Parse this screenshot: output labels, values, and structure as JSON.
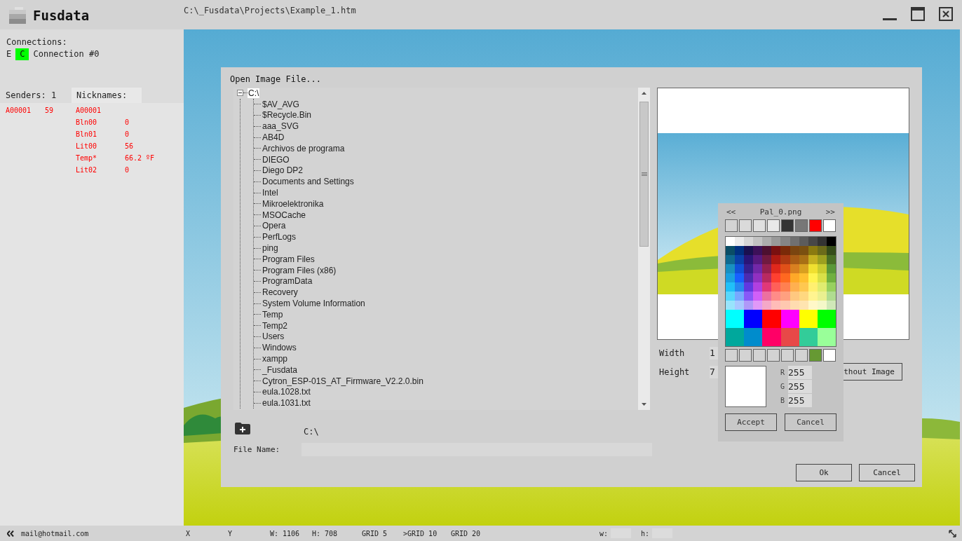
{
  "app": {
    "title": "Fusdata",
    "file_path": "C:\\_Fusdata\\Projects\\Example_1.htm"
  },
  "connections": {
    "label": "Connections:",
    "items": [
      {
        "prefix": "E",
        "badge": "C",
        "name": "Connection #0",
        "color": "#00ff00"
      }
    ]
  },
  "senders": {
    "label": "Senders: 1",
    "rows": [
      {
        "id": "A00001",
        "value": "59"
      }
    ]
  },
  "nicknames": {
    "label": "Nicknames:",
    "rows": [
      {
        "name": "A00001"
      },
      {
        "name": "Bln00",
        "value": "0"
      },
      {
        "name": "Bln01",
        "value": "0"
      },
      {
        "name": "Lit00",
        "value": "56"
      },
      {
        "name": "Temp*",
        "value": "66.2 ºF"
      },
      {
        "name": "Lit02",
        "value": "0"
      }
    ]
  },
  "dialog": {
    "title": "Open Image File...",
    "tree": {
      "label": "C:\\",
      "expanded": true,
      "selected": true,
      "children": [
        {
          "label": "$AV_AVG",
          "selected": false
        },
        {
          "label": "$Recycle.Bin",
          "selected": false
        },
        {
          "label": "aaa_SVG",
          "selected": false
        },
        {
          "label": "AB4D",
          "selected": false
        },
        {
          "label": "Archivos de programa",
          "selected": false
        },
        {
          "label": "DIEGO",
          "selected": false
        },
        {
          "label": "Diego DP2",
          "selected": false
        },
        {
          "label": "Documents and Settings",
          "selected": false
        },
        {
          "label": "Intel",
          "selected": false
        },
        {
          "label": "Mikroelektronika",
          "selected": false
        },
        {
          "label": "MSOCache",
          "selected": false
        },
        {
          "label": "Opera",
          "selected": false
        },
        {
          "label": "PerfLogs",
          "selected": false
        },
        {
          "label": "ping",
          "selected": false
        },
        {
          "label": "Program Files",
          "selected": false
        },
        {
          "label": "Program Files (x86)",
          "selected": false
        },
        {
          "label": "ProgramData",
          "selected": false
        },
        {
          "label": "Recovery",
          "selected": false
        },
        {
          "label": "System Volume Information",
          "selected": false
        },
        {
          "label": "Temp",
          "selected": false
        },
        {
          "label": "Temp2",
          "selected": false
        },
        {
          "label": "Users",
          "selected": false
        },
        {
          "label": "Windows",
          "selected": false
        },
        {
          "label": "xampp",
          "selected": false
        },
        {
          "label": "_Fusdata",
          "selected": false
        },
        {
          "label": "Cytron_ESP-01S_AT_Firmware_V2.2.0.bin",
          "selected": false
        },
        {
          "label": "eula.1028.txt",
          "selected": false
        },
        {
          "label": "eula.1031.txt",
          "selected": false
        }
      ]
    },
    "path": "C:\\",
    "file_name_label": "File Name:",
    "width_label": "Width",
    "width_value": "1",
    "height_label": "Height",
    "height_value": "7",
    "partial_button": "thout Image",
    "buttons": [
      {
        "label": "Ok"
      },
      {
        "label": "Cancel"
      }
    ]
  },
  "palette": {
    "prev": "<<",
    "title": "Pal_0.png",
    "next": ">>",
    "favorites": [
      {
        "color": "#d3d3d3"
      },
      {
        "color": "#dadada"
      },
      {
        "color": "#e0e0e0"
      },
      {
        "color": "#e8e8e8"
      },
      {
        "color": "#333333"
      },
      {
        "color": "#777777"
      },
      {
        "color": "#ff0000"
      },
      {
        "color": "#ffffff"
      }
    ],
    "grid": [
      [
        {
          "color": "#ffffff"
        },
        {
          "color": "#ebebeb"
        },
        {
          "color": "#d6d6d6"
        },
        {
          "color": "#c2c2c2"
        },
        {
          "color": "#adadad"
        },
        {
          "color": "#999999"
        },
        {
          "color": "#858585"
        },
        {
          "color": "#707070"
        },
        {
          "color": "#5c5c5c"
        },
        {
          "color": "#474747"
        },
        {
          "color": "#333333"
        },
        {
          "color": "#000000"
        }
      ],
      [
        {
          "color": "#0a4d66"
        },
        {
          "color": "#003080"
        },
        {
          "color": "#1a1050"
        },
        {
          "color": "#3d1059"
        },
        {
          "color": "#4d1030"
        },
        {
          "color": "#7a1010"
        },
        {
          "color": "#7a2a08"
        },
        {
          "color": "#7a4510"
        },
        {
          "color": "#7a5010"
        },
        {
          "color": "#8a7a10"
        },
        {
          "color": "#6b6b1a"
        },
        {
          "color": "#364d1a"
        }
      ],
      [
        {
          "color": "#0f6a90"
        },
        {
          "color": "#0a40a8"
        },
        {
          "color": "#2a1578"
        },
        {
          "color": "#581a80"
        },
        {
          "color": "#701a40"
        },
        {
          "color": "#ae1a12"
        },
        {
          "color": "#ad3a12"
        },
        {
          "color": "#a85c15"
        },
        {
          "color": "#a87015"
        },
        {
          "color": "#c4b020"
        },
        {
          "color": "#9ca020"
        },
        {
          "color": "#4a7025"
        }
      ],
      [
        {
          "color": "#1990c0"
        },
        {
          "color": "#1050d8"
        },
        {
          "color": "#362090"
        },
        {
          "color": "#7228a8"
        },
        {
          "color": "#952050"
        },
        {
          "color": "#e0281c"
        },
        {
          "color": "#e05018"
        },
        {
          "color": "#d88020"
        },
        {
          "color": "#d8a020"
        },
        {
          "color": "#f0e030"
        },
        {
          "color": "#c8cc30"
        },
        {
          "color": "#5a9838"
        }
      ],
      [
        {
          "color": "#1aa0e0"
        },
        {
          "color": "#1860ff"
        },
        {
          "color": "#4a2cb0"
        },
        {
          "color": "#9030c0"
        },
        {
          "color": "#b82a60"
        },
        {
          "color": "#ff4030"
        },
        {
          "color": "#ff6820"
        },
        {
          "color": "#ffa828"
        },
        {
          "color": "#ffc030"
        },
        {
          "color": "#fff450"
        },
        {
          "color": "#d8e048"
        },
        {
          "color": "#70b040"
        }
      ],
      [
        {
          "color": "#20c0f8"
        },
        {
          "color": "#2888f0"
        },
        {
          "color": "#6038e0"
        },
        {
          "color": "#b040e0"
        },
        {
          "color": "#e03878"
        },
        {
          "color": "#ff6058"
        },
        {
          "color": "#ff8050"
        },
        {
          "color": "#ffb050"
        },
        {
          "color": "#ffc850"
        },
        {
          "color": "#fff070"
        },
        {
          "color": "#e0ec70"
        },
        {
          "color": "#98d060"
        }
      ],
      [
        {
          "color": "#58d8fc"
        },
        {
          "color": "#78a8ff"
        },
        {
          "color": "#8858f8"
        },
        {
          "color": "#d060f8"
        },
        {
          "color": "#ec70a0"
        },
        {
          "color": "#ff8c88"
        },
        {
          "color": "#ffa080"
        },
        {
          "color": "#ffc880"
        },
        {
          "color": "#ffd880"
        },
        {
          "color": "#fff490"
        },
        {
          "color": "#eaf090"
        },
        {
          "color": "#b0dc90"
        }
      ],
      [
        {
          "color": "#98e4fc"
        },
        {
          "color": "#a8c8ff"
        },
        {
          "color": "#b098f8"
        },
        {
          "color": "#e098f8"
        },
        {
          "color": "#f4a8c8"
        },
        {
          "color": "#ffbcb8"
        },
        {
          "color": "#ffc8b0"
        },
        {
          "color": "#ffdcb0"
        },
        {
          "color": "#ffe4b0"
        },
        {
          "color": "#fff8c8"
        },
        {
          "color": "#f4f8c8"
        },
        {
          "color": "#d0e8b8"
        }
      ]
    ],
    "bright": [
      [
        {
          "color": "#00ffff"
        },
        {
          "color": "#0000ff"
        },
        {
          "color": "#ff0000"
        },
        {
          "color": "#ff00ff"
        },
        {
          "color": "#ffff00"
        },
        {
          "color": "#00ff00"
        }
      ],
      [
        {
          "color": "#00a89c"
        },
        {
          "color": "#008ccc"
        },
        {
          "color": "#ff0066"
        },
        {
          "color": "#e84848"
        },
        {
          "color": "#33cc99"
        },
        {
          "color": "#99ff99"
        }
      ]
    ],
    "recent": [
      {
        "color": "#d3d3d3"
      },
      {
        "color": "#d3d3d3"
      },
      {
        "color": "#d3d3d3"
      },
      {
        "color": "#d3d3d3"
      },
      {
        "color": "#d3d3d3"
      },
      {
        "color": "#d3d3d3"
      },
      {
        "color": "#669933"
      },
      {
        "color": "#ffffff"
      }
    ],
    "current": {
      "color": "#ffffff"
    },
    "channels": [
      {
        "label": "R",
        "value": "255"
      },
      {
        "label": "G",
        "value": "255"
      },
      {
        "label": "B",
        "value": "255"
      }
    ],
    "buttons": [
      {
        "label": "Accept"
      },
      {
        "label": "Cancel"
      }
    ]
  },
  "status_bar": {
    "email": "mail@hotmail.com",
    "items": [
      "X",
      "Y",
      "W: 1106",
      "H: 708",
      "GRID 5",
      ">GRID 10",
      "GRID 20"
    ],
    "w_label": "w:",
    "h_label": "h:"
  }
}
